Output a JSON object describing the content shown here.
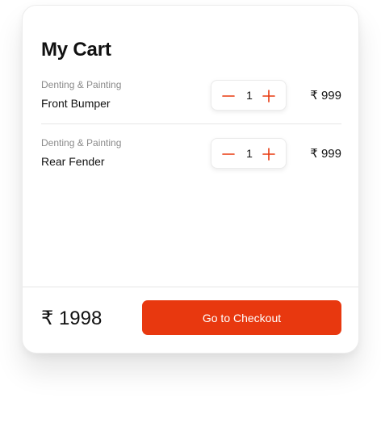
{
  "cart": {
    "title": "My Cart",
    "items": [
      {
        "category": "Denting & Painting",
        "name": "Front Bumper",
        "quantity": "1",
        "price": "₹ 999"
      },
      {
        "category": "Denting & Painting",
        "name": "Rear Fender",
        "quantity": "1",
        "price": "₹ 999"
      }
    ],
    "total": "₹ 1998",
    "checkout_label": "Go to Checkout"
  },
  "icons": {
    "decrement": "minus-icon",
    "increment": "plus-icon"
  },
  "colors": {
    "accent": "#e8380f",
    "text": "#111111",
    "muted": "#8a8a8a"
  }
}
